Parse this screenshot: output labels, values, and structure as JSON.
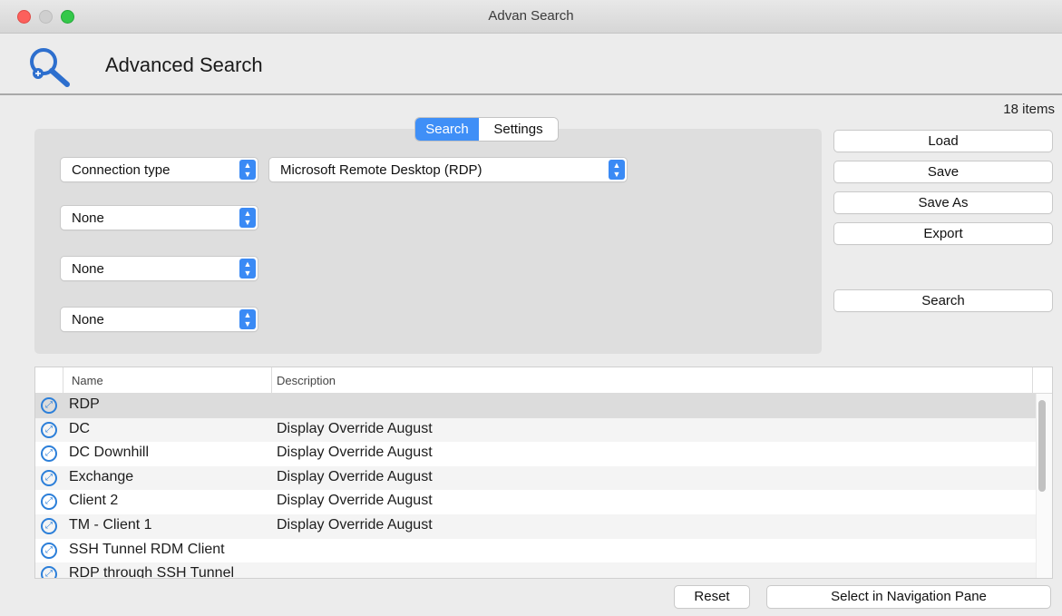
{
  "window": {
    "title": "Advan Search"
  },
  "header": {
    "title": "Advanced Search"
  },
  "item_count": "18 items",
  "tabs": {
    "search": "Search",
    "settings": "Settings"
  },
  "criteria": [
    {
      "field": "Connection type",
      "value": "Microsoft Remote Desktop (RDP)"
    },
    {
      "field": "None"
    },
    {
      "field": "None"
    },
    {
      "field": "None"
    }
  ],
  "actions": {
    "load": "Load",
    "save": "Save",
    "save_as": "Save As",
    "export": "Export",
    "search": "Search"
  },
  "table": {
    "columns": [
      "Name",
      "Description"
    ],
    "rows": [
      {
        "name": "RDP",
        "description": ""
      },
      {
        "name": "DC",
        "description": "Display Override August"
      },
      {
        "name": "DC Downhill",
        "description": "Display Override August"
      },
      {
        "name": "Exchange",
        "description": "Display Override August"
      },
      {
        "name": "Client 2",
        "description": "Display Override August"
      },
      {
        "name": "TM - Client 1",
        "description": "Display Override August"
      },
      {
        "name": "SSH Tunnel RDM Client",
        "description": ""
      },
      {
        "name": "RDP through SSH Tunnel",
        "description": ""
      }
    ]
  },
  "footer": {
    "reset": "Reset",
    "select_nav": "Select in Navigation Pane"
  },
  "colors": {
    "accent": "#3f8ff7",
    "icon_blue": "#2c7fd9",
    "selected_row": "#dcdcdc"
  }
}
